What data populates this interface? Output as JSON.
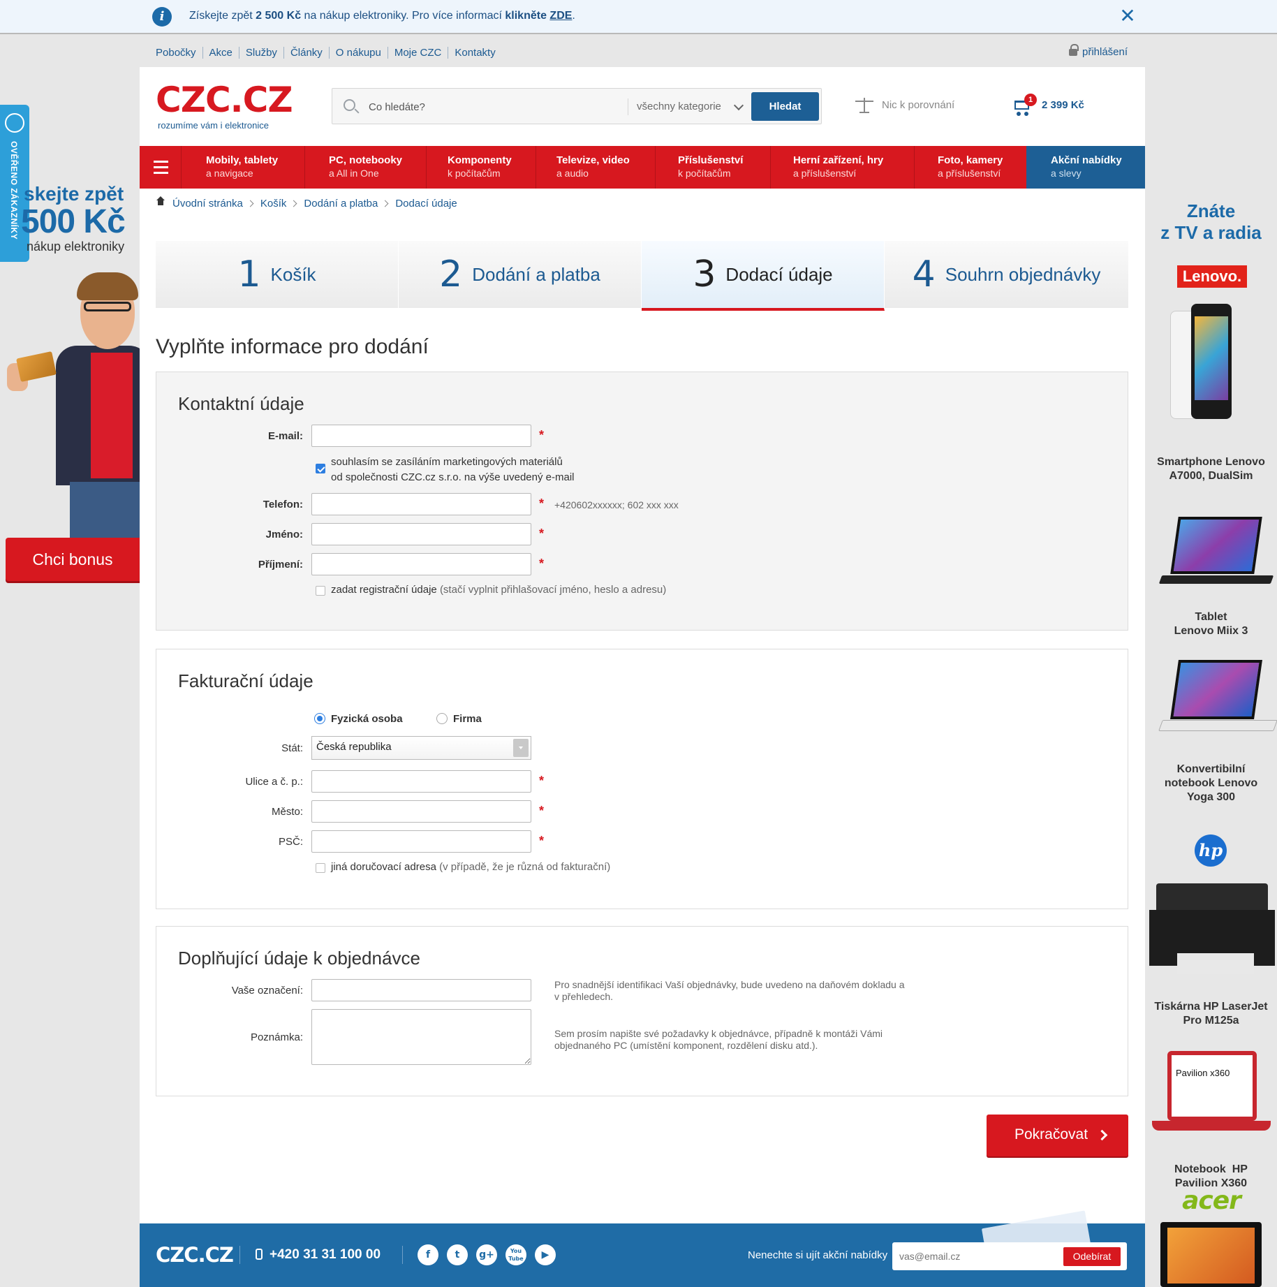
{
  "topbar": {
    "msg_pre": "Získejte zpět ",
    "msg_amount": "2 500 Kč",
    "msg_mid": " na nákup elektroniky. Pro více informací ",
    "msg_bold": "klikněte",
    "msg_link": "ZDE",
    "msg_end": ".",
    "close": "✕"
  },
  "secnav": [
    "Pobočky",
    "Akce",
    "Služby",
    "Články",
    "O nákupu",
    "Moje CZC",
    "Kontakty"
  ],
  "login": "přihlášení",
  "logo": {
    "brand": "CZC.CZ",
    "tagline": "rozumíme vám i elektronice"
  },
  "search": {
    "placeholder": "Co hledáte?",
    "category": "všechny kategorie",
    "button": "Hledat"
  },
  "compare": "Nic k porovnání",
  "cart": {
    "count": "1",
    "price": "2 399 Kč"
  },
  "rednav": [
    {
      "t1": "Mobily, tablety",
      "t2": "a navigace"
    },
    {
      "t1": "PC, notebooky",
      "t2": "a All in One"
    },
    {
      "t1": "Komponenty",
      "t2": "k počítačům"
    },
    {
      "t1": "Televize, video",
      "t2": "a audio"
    },
    {
      "t1": "Příslušenství",
      "t2": "k počítačům"
    },
    {
      "t1": "Herní zařízení, hry",
      "t2": "a příslušenství"
    },
    {
      "t1": "Foto, kamery",
      "t2": "a příslušenství"
    },
    {
      "t1": "Akční nabídky",
      "t2": "a slevy"
    }
  ],
  "breadcrumb": [
    "Úvodní stránka",
    "Košík",
    "Dodání a platba",
    "Dodací údaje"
  ],
  "steps": [
    {
      "num": "1",
      "label": "Košík"
    },
    {
      "num": "2",
      "label": "Dodání a platba"
    },
    {
      "num": "3",
      "label": "Dodací údaje"
    },
    {
      "num": "4",
      "label": "Souhrn objednávky"
    }
  ],
  "page_title": "Vyplňte informace pro dodání",
  "contact": {
    "heading": "Kontaktní údaje",
    "email_label": "E-mail:",
    "consent_line1": "souhlasím se zasíláním marketingových materiálů",
    "consent_line2": "od společnosti CZC.cz s.r.o. na výše uvedený e-mail",
    "phone_label": "Telefon:",
    "phone_hint": "+420602xxxxxx; 602 xxx xxx",
    "firstname_label": "Jméno:",
    "lastname_label": "Příjmení:",
    "register_label": "zadat registrační údaje",
    "register_hint": "(stačí vyplnit přihlašovací jméno, heslo a adresu)",
    "required": "*"
  },
  "billing": {
    "heading": "Fakturační údaje",
    "radio_person": "Fyzická osoba",
    "radio_company": "Firma",
    "country_label": "Stát:",
    "country_value": "Česká republika",
    "street_label": "Ulice a č. p.:",
    "city_label": "Město:",
    "zip_label": "PSČ:",
    "other_address_label": "jiná doručovací adresa",
    "other_address_hint": "(v případě, že je různá od fakturační)"
  },
  "extra": {
    "heading": "Doplňující údaje k objednávce",
    "ref_label": "Vaše označení:",
    "ref_hint1": "Pro snadnější identifikaci Vaší objednávky, bude uvedeno na daňovém dokladu a",
    "ref_hint2": "v přehledech.",
    "note_label": "Poznámka:",
    "note_hint1": "Sem prosím napište své požadavky k objednávce, případně k montáži Vámi",
    "note_hint2": "objednaného PC (umístění komponent, rozdělení disku atd.)."
  },
  "continue_button": "Pokračovat",
  "footer": {
    "logo": "CZC.CZ",
    "phone": "+420 31 31 100 00",
    "social": [
      "f",
      "t",
      "g+",
      "You Tube",
      "▶"
    ],
    "newsletter_label": "Nenechte si ujít akční nabídky",
    "newsletter_placeholder": "vas@email.cz",
    "subscribe": "Odebírat"
  },
  "left_ad": {
    "verified": "OVĚŘENO ZÁKAZNÍKY",
    "line1": "skejte zpět",
    "line2": "500 Kč",
    "line3": "nákup elektroniky",
    "cta": "Chci bonus"
  },
  "right_ad": {
    "heading1": "Znáte",
    "heading2": "z TV a radia",
    "lenovo": "Lenovo.",
    "items": [
      {
        "line1": "Smartphone Lenovo",
        "line2": "A7000, DualSim"
      },
      {
        "line1": "Tablet",
        "line2": "Lenovo Miix 3"
      },
      {
        "line1": "Konvertibilní",
        "line2": "notebook Lenovo",
        "line3": "Yoga 300"
      },
      {
        "line1": "Tiskárna HP LaserJet",
        "line2": "Pro M125a"
      },
      {
        "line1": "Notebook  HP",
        "line2": "Pavilion X360"
      }
    ],
    "hp": "hp",
    "pavilion_screen": "Pavilion x360",
    "acer": "acer"
  }
}
